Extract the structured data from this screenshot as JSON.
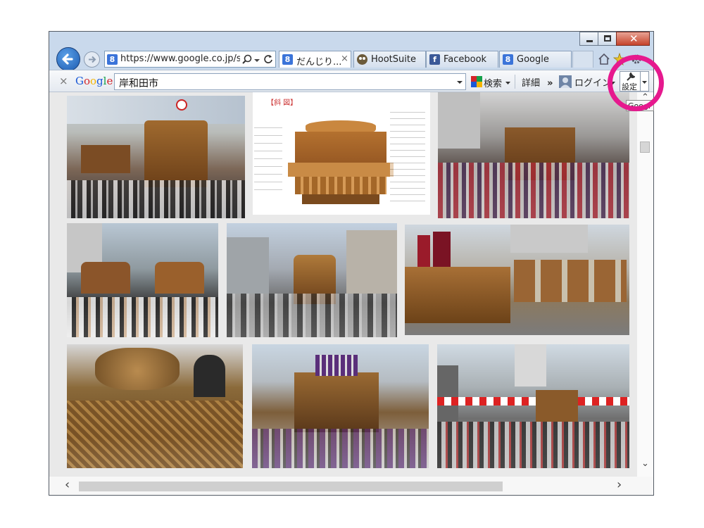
{
  "browser": {
    "address_url": "https://www.google.co.jp/se",
    "tabs": [
      {
        "label": "だんじり...",
        "favicon": "google-favicon-icon",
        "active": true
      },
      {
        "label": "HootSuite",
        "favicon": "hootsuite-owl-icon",
        "active": false
      },
      {
        "label": "Facebook",
        "favicon": "facebook-favicon-icon",
        "active": false
      },
      {
        "label": "Google",
        "favicon": "google-favicon-icon",
        "active": false
      }
    ],
    "tab_close_glyph": "×",
    "favicon_letters": {
      "google": "8",
      "facebook": "f"
    }
  },
  "google_toolbar": {
    "close_glyph": "×",
    "logo_text": "Google",
    "logo_colors": [
      "#1a58d6",
      "#d3252a",
      "#f4b400",
      "#1a58d6",
      "#15a04a",
      "#d3252a"
    ],
    "search_value": "岸和田市",
    "search_button_label": "検索",
    "more_label": "詳細",
    "more_arrows": "»",
    "login_label": "ログイン",
    "settings_label": "設定",
    "tooltip_text": "Googl"
  },
  "scrollbars": {
    "up_glyph": "⌃",
    "down_glyph": "⌄",
    "left_glyph": "‹",
    "right_glyph": "›"
  },
  "highlight_color": "#e6198e",
  "image_results": [
    {
      "row": 1,
      "subject": "danjiri-float-crowd-street"
    },
    {
      "row": 1,
      "subject": "danjiri-parts-diagram"
    },
    {
      "row": 1,
      "subject": "danjiri-float-red-happi-crowd"
    },
    {
      "row": 2,
      "subject": "two-danjiri-floats-crowd"
    },
    {
      "row": 2,
      "subject": "danjiri-float-street-dancer"
    },
    {
      "row": 2,
      "subject": "danjiri-floats-with-banners"
    },
    {
      "row": 3,
      "subject": "danjiri-carving-closeup"
    },
    {
      "row": 3,
      "subject": "danjiri-float-purple-team"
    },
    {
      "row": 3,
      "subject": "danjiri-float-intersection"
    }
  ]
}
